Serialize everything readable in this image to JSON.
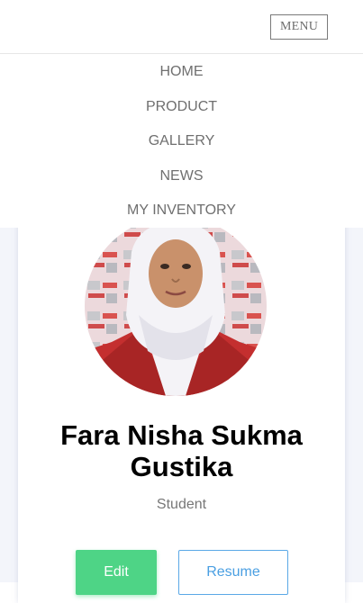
{
  "header": {
    "menu_label": "MENU"
  },
  "nav": {
    "items": [
      {
        "label": "HOME"
      },
      {
        "label": "PRODUCT"
      },
      {
        "label": "GALLERY"
      },
      {
        "label": "NEWS"
      },
      {
        "label": "MY INVENTORY"
      }
    ]
  },
  "profile": {
    "name": "Fara Nisha Sukma Gustika",
    "role": "Student",
    "edit_label": "Edit",
    "resume_label": "Resume"
  },
  "colors": {
    "edit_button": "#4ed486",
    "resume_border": "#5aa8e6",
    "page_background": "#f3f5fa"
  }
}
